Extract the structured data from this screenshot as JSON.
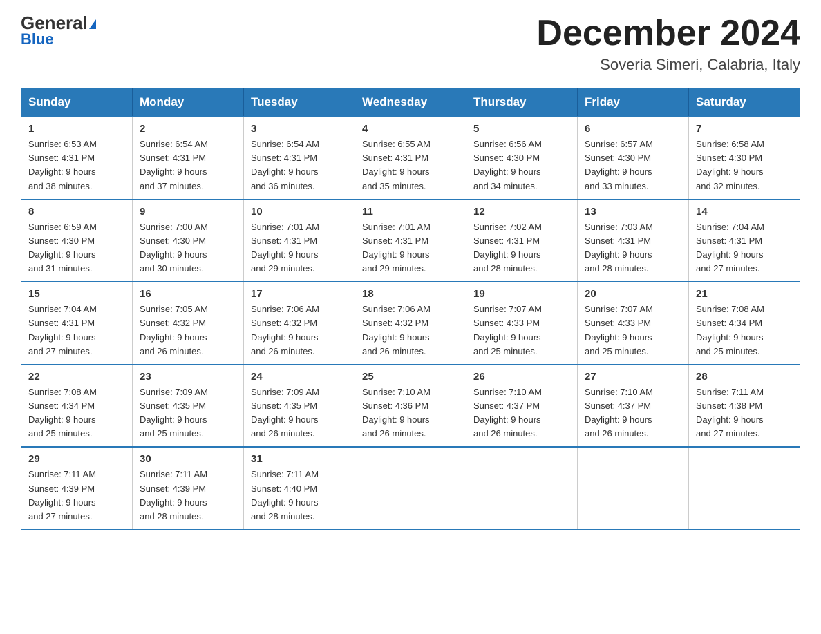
{
  "logo": {
    "general": "General",
    "blue": "Blue"
  },
  "header": {
    "month": "December 2024",
    "location": "Soveria Simeri, Calabria, Italy"
  },
  "days_of_week": [
    "Sunday",
    "Monday",
    "Tuesday",
    "Wednesday",
    "Thursday",
    "Friday",
    "Saturday"
  ],
  "weeks": [
    [
      {
        "day": "1",
        "sunrise": "6:53 AM",
        "sunset": "4:31 PM",
        "daylight": "9 hours and 38 minutes."
      },
      {
        "day": "2",
        "sunrise": "6:54 AM",
        "sunset": "4:31 PM",
        "daylight": "9 hours and 37 minutes."
      },
      {
        "day": "3",
        "sunrise": "6:54 AM",
        "sunset": "4:31 PM",
        "daylight": "9 hours and 36 minutes."
      },
      {
        "day": "4",
        "sunrise": "6:55 AM",
        "sunset": "4:31 PM",
        "daylight": "9 hours and 35 minutes."
      },
      {
        "day": "5",
        "sunrise": "6:56 AM",
        "sunset": "4:30 PM",
        "daylight": "9 hours and 34 minutes."
      },
      {
        "day": "6",
        "sunrise": "6:57 AM",
        "sunset": "4:30 PM",
        "daylight": "9 hours and 33 minutes."
      },
      {
        "day": "7",
        "sunrise": "6:58 AM",
        "sunset": "4:30 PM",
        "daylight": "9 hours and 32 minutes."
      }
    ],
    [
      {
        "day": "8",
        "sunrise": "6:59 AM",
        "sunset": "4:30 PM",
        "daylight": "9 hours and 31 minutes."
      },
      {
        "day": "9",
        "sunrise": "7:00 AM",
        "sunset": "4:30 PM",
        "daylight": "9 hours and 30 minutes."
      },
      {
        "day": "10",
        "sunrise": "7:01 AM",
        "sunset": "4:31 PM",
        "daylight": "9 hours and 29 minutes."
      },
      {
        "day": "11",
        "sunrise": "7:01 AM",
        "sunset": "4:31 PM",
        "daylight": "9 hours and 29 minutes."
      },
      {
        "day": "12",
        "sunrise": "7:02 AM",
        "sunset": "4:31 PM",
        "daylight": "9 hours and 28 minutes."
      },
      {
        "day": "13",
        "sunrise": "7:03 AM",
        "sunset": "4:31 PM",
        "daylight": "9 hours and 28 minutes."
      },
      {
        "day": "14",
        "sunrise": "7:04 AM",
        "sunset": "4:31 PM",
        "daylight": "9 hours and 27 minutes."
      }
    ],
    [
      {
        "day": "15",
        "sunrise": "7:04 AM",
        "sunset": "4:31 PM",
        "daylight": "9 hours and 27 minutes."
      },
      {
        "day": "16",
        "sunrise": "7:05 AM",
        "sunset": "4:32 PM",
        "daylight": "9 hours and 26 minutes."
      },
      {
        "day": "17",
        "sunrise": "7:06 AM",
        "sunset": "4:32 PM",
        "daylight": "9 hours and 26 minutes."
      },
      {
        "day": "18",
        "sunrise": "7:06 AM",
        "sunset": "4:32 PM",
        "daylight": "9 hours and 26 minutes."
      },
      {
        "day": "19",
        "sunrise": "7:07 AM",
        "sunset": "4:33 PM",
        "daylight": "9 hours and 25 minutes."
      },
      {
        "day": "20",
        "sunrise": "7:07 AM",
        "sunset": "4:33 PM",
        "daylight": "9 hours and 25 minutes."
      },
      {
        "day": "21",
        "sunrise": "7:08 AM",
        "sunset": "4:34 PM",
        "daylight": "9 hours and 25 minutes."
      }
    ],
    [
      {
        "day": "22",
        "sunrise": "7:08 AM",
        "sunset": "4:34 PM",
        "daylight": "9 hours and 25 minutes."
      },
      {
        "day": "23",
        "sunrise": "7:09 AM",
        "sunset": "4:35 PM",
        "daylight": "9 hours and 25 minutes."
      },
      {
        "day": "24",
        "sunrise": "7:09 AM",
        "sunset": "4:35 PM",
        "daylight": "9 hours and 26 minutes."
      },
      {
        "day": "25",
        "sunrise": "7:10 AM",
        "sunset": "4:36 PM",
        "daylight": "9 hours and 26 minutes."
      },
      {
        "day": "26",
        "sunrise": "7:10 AM",
        "sunset": "4:37 PM",
        "daylight": "9 hours and 26 minutes."
      },
      {
        "day": "27",
        "sunrise": "7:10 AM",
        "sunset": "4:37 PM",
        "daylight": "9 hours and 26 minutes."
      },
      {
        "day": "28",
        "sunrise": "7:11 AM",
        "sunset": "4:38 PM",
        "daylight": "9 hours and 27 minutes."
      }
    ],
    [
      {
        "day": "29",
        "sunrise": "7:11 AM",
        "sunset": "4:39 PM",
        "daylight": "9 hours and 27 minutes."
      },
      {
        "day": "30",
        "sunrise": "7:11 AM",
        "sunset": "4:39 PM",
        "daylight": "9 hours and 28 minutes."
      },
      {
        "day": "31",
        "sunrise": "7:11 AM",
        "sunset": "4:40 PM",
        "daylight": "9 hours and 28 minutes."
      },
      null,
      null,
      null,
      null
    ]
  ]
}
